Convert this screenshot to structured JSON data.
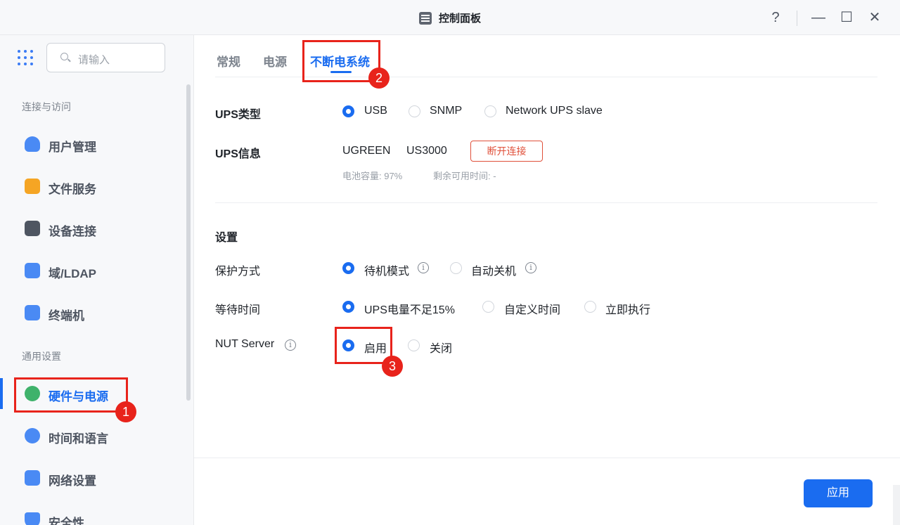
{
  "window": {
    "title": "控制面板",
    "help": "?",
    "minimize": "—",
    "maximize": "☐",
    "close": "✕"
  },
  "sidebar": {
    "search_placeholder": "请输入",
    "sections": [
      {
        "label": "连接与访问"
      },
      {
        "label": "通用设置"
      }
    ],
    "items": [
      {
        "label": "用户管理",
        "icon": "user-icon",
        "color": "#4a8af4"
      },
      {
        "label": "文件服务",
        "icon": "folder-icon",
        "color": "#f5a524"
      },
      {
        "label": "设备连接",
        "icon": "device-icon",
        "color": "#4e5561"
      },
      {
        "label": "域/LDAP",
        "icon": "domain-icon",
        "color": "#4a8af4"
      },
      {
        "label": "终端机",
        "icon": "terminal-icon",
        "color": "#4a8af4"
      },
      {
        "label": "硬件与电源",
        "icon": "battery-icon",
        "color": "#3fb26b",
        "active": true
      },
      {
        "label": "时间和语言",
        "icon": "globe-icon",
        "color": "#4a8af4"
      },
      {
        "label": "网络设置",
        "icon": "network-icon",
        "color": "#4a8af4"
      },
      {
        "label": "安全性",
        "icon": "shield-icon",
        "color": "#4a8af4"
      }
    ]
  },
  "tabs": [
    {
      "label": "常规"
    },
    {
      "label": "电源"
    },
    {
      "label": "不断电系统",
      "active": true
    }
  ],
  "ups": {
    "type_label": "UPS类型",
    "type_options": [
      "USB",
      "SNMP",
      "Network UPS slave"
    ],
    "type_selected": "USB",
    "info_label": "UPS信息",
    "brand": "UGREEN",
    "model": "US3000",
    "disconnect_label": "断开连接",
    "battery_text": "电池容量: 97%",
    "remaining_text": "剩余可用时间: -"
  },
  "settings": {
    "heading": "设置",
    "protection_label": "保护方式",
    "protection_options": [
      "待机模式",
      "自动关机"
    ],
    "protection_selected": "待机模式",
    "wait_label": "等待时间",
    "wait_options": [
      "UPS电量不足15%",
      "自定义时间",
      "立即执行"
    ],
    "wait_selected": "UPS电量不足15%",
    "nut_label": "NUT Server",
    "nut_options": [
      "启用",
      "关闭"
    ],
    "nut_selected": "启用"
  },
  "footer": {
    "apply_label": "应用"
  },
  "annotations": [
    {
      "number": "1",
      "color": "#e8231b"
    },
    {
      "number": "2",
      "color": "#e8231b"
    },
    {
      "number": "3",
      "color": "#e8231b"
    }
  ],
  "colors": {
    "accent": "#1a6cf0",
    "danger": "#e0503a",
    "annotation": "#e8231b"
  }
}
